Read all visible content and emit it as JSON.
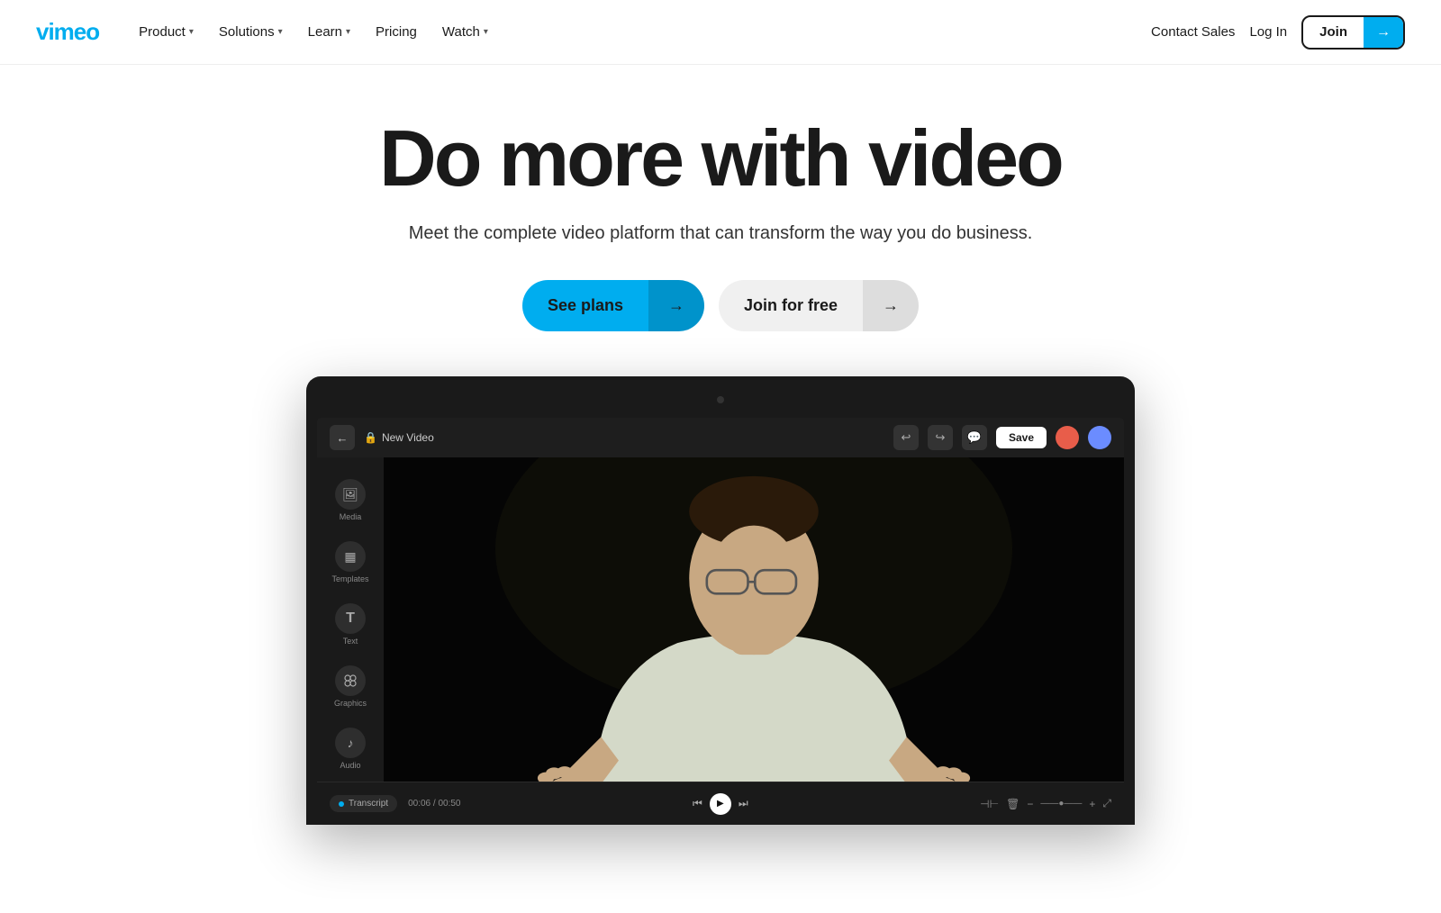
{
  "nav": {
    "logo": "vimeo",
    "items": [
      {
        "label": "Product",
        "hasDropdown": true
      },
      {
        "label": "Solutions",
        "hasDropdown": true
      },
      {
        "label": "Learn",
        "hasDropdown": true
      },
      {
        "label": "Pricing",
        "hasDropdown": false
      },
      {
        "label": "Watch",
        "hasDropdown": true
      }
    ],
    "contact_sales": "Contact Sales",
    "log_in": "Log In",
    "join": "Join",
    "join_arrow": "→"
  },
  "hero": {
    "title": "Do more with video",
    "subtitle": "Meet the complete video platform that can transform the way you do business.",
    "btn_plans": "See plans",
    "btn_plans_arrow": "→",
    "btn_free": "Join for free",
    "btn_free_arrow": "→"
  },
  "editor": {
    "title": "New Video",
    "lock_icon": "🔒",
    "back_arrow": "←",
    "undo": "↩",
    "redo": "↪",
    "chat_icon": "💬",
    "save_label": "Save",
    "sidebar_tools": [
      {
        "icon": "🖼",
        "label": "Media"
      },
      {
        "icon": "▦",
        "label": "Templates"
      },
      {
        "icon": "T",
        "label": "Text"
      },
      {
        "icon": "⚙",
        "label": "Graphics"
      },
      {
        "icon": "♪",
        "label": "Audio"
      }
    ],
    "transcript_label": "Transcript",
    "time_current": "00:06",
    "time_total": "00:50",
    "play_icon": "▶",
    "skip_back": "⏮",
    "skip_forward": "⏭"
  }
}
